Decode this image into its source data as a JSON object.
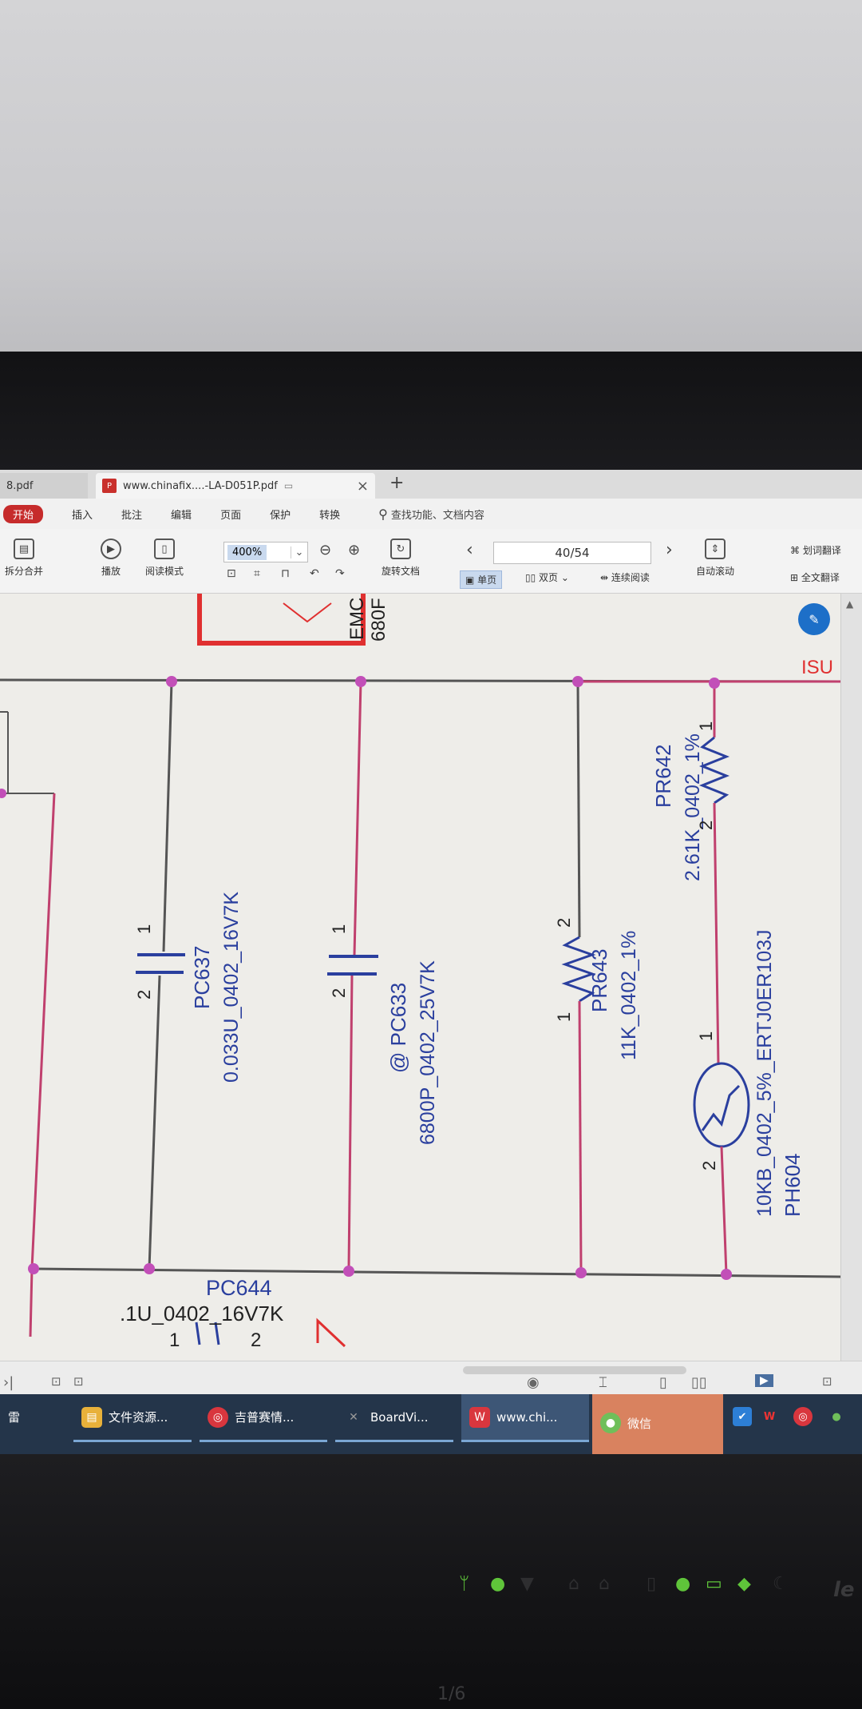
{
  "tabs": {
    "previous": {
      "label": "8.pdf"
    },
    "active": {
      "label": "www.chinafix....-LA-D051P.pdf",
      "icon": "pdf-icon"
    }
  },
  "menu": {
    "start": "开始",
    "items": [
      "插入",
      "批注",
      "编辑",
      "页面",
      "保护",
      "转换"
    ],
    "search": "查找功能、文档内容"
  },
  "toolbar": {
    "split_merge": "拆分合并",
    "play": "播放",
    "read_mode": "阅读模式",
    "zoom_value": "400%",
    "rotate": "旋转文档",
    "page_indicator": "40/54",
    "single_page": "单页",
    "double_page": "双页",
    "continuous": "连续阅读",
    "auto_scroll": "自动滚动",
    "word_translate": "划词翻译",
    "full_translate": "全文翻译"
  },
  "schematic": {
    "top_label_1": "EMC",
    "top_label_2": "680F",
    "net_label": "ISU",
    "components": [
      {
        "ref": "PC637",
        "value": "0.033U_0402_16V7K",
        "pin1": "1",
        "pin2": "2"
      },
      {
        "ref": "@ PC633",
        "value": "6800P_0402_25V7K",
        "pin1": "1",
        "pin2": "2"
      },
      {
        "ref": "PR643",
        "value": "11K_0402_1%",
        "pin1": "1",
        "pin2": "2"
      },
      {
        "ref": "PR642",
        "value": "2.61K_0402_1%",
        "pin1": "1",
        "pin2": "2"
      },
      {
        "ref": "PH604",
        "value": "10KB_0402_5%_ERTJ0ER103J",
        "pin1": "1",
        "pin2": "2"
      },
      {
        "ref": "PC644",
        "value": ".1U_0402_16V7K",
        "pin1": "1",
        "pin2": "2"
      }
    ]
  },
  "taskbar": {
    "items": [
      {
        "label": "雷"
      },
      {
        "label": "文件资源..."
      },
      {
        "label": "吉普赛情..."
      },
      {
        "label": "BoardVi..."
      },
      {
        "label": "www.chi..."
      },
      {
        "label": "微信"
      }
    ]
  },
  "bezel": {
    "brand": "le",
    "bottom_mark": "1/6"
  },
  "colors": {
    "wire": "#c0406e",
    "component": "#2a3f9e",
    "junction": "#c24fb8",
    "highlight_box": "#e03030",
    "taskbar": "#24354a",
    "wechat_task": "#d9825f"
  }
}
